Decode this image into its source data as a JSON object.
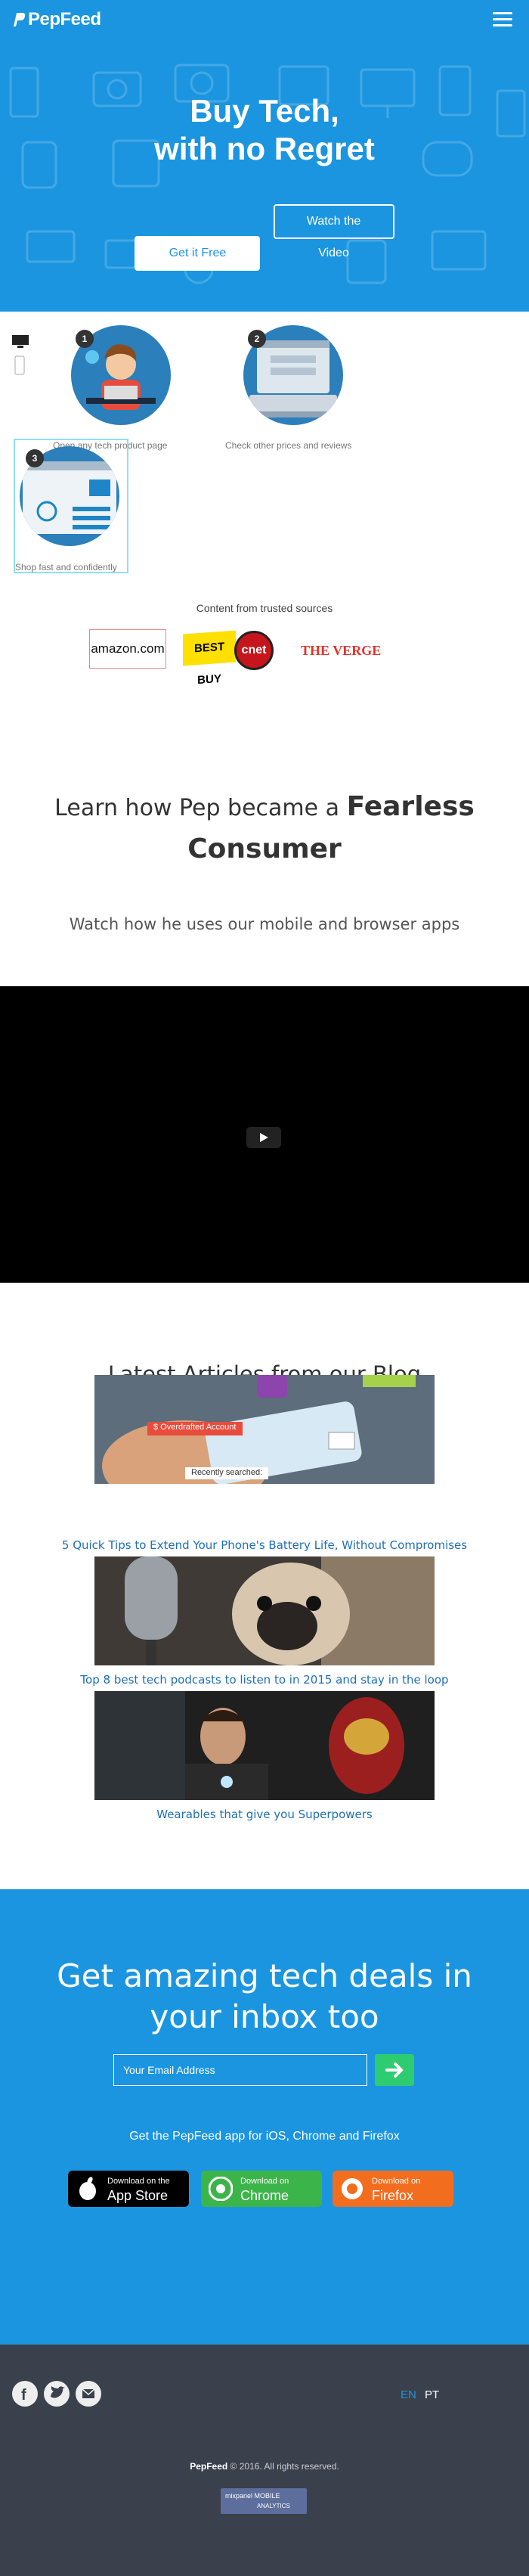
{
  "nav": {
    "logo": "PepFeed"
  },
  "hero": {
    "title_line1": "Buy Tech,",
    "title_line2": "with no Regret",
    "cta_primary": "Get it Free",
    "cta_secondary": "Watch the Video"
  },
  "steps": [
    {
      "number": "1",
      "caption": "Open any tech product page"
    },
    {
      "number": "2",
      "caption": "Check other prices and reviews"
    },
    {
      "number": "3",
      "caption": "Shop fast and confidently"
    }
  ],
  "sources": {
    "title": "Content from trusted sources",
    "logos": [
      "amazon.com",
      "BEST BUY",
      "cnet",
      "THE VERGE"
    ]
  },
  "learn": {
    "prefix": "Learn how Pep became a",
    "bold_1": "Fearless",
    "bold_2": "Consumer",
    "subtitle": "Watch how he uses our mobile and browser apps"
  },
  "blog": {
    "title": "Latest Articles from our Blog",
    "articles": [
      {
        "title": "5 Quick Tips to Extend Your Phone's Battery Life, Without Compromises",
        "img_text_1": "$ Overdrafted Account",
        "img_text_2": "Recently searched:"
      },
      {
        "title": "Top 8 best tech podcasts to listen to in 2015 and stay in the loop"
      },
      {
        "title": "Wearables that give you Superpowers"
      }
    ]
  },
  "newsletter": {
    "title_line1": "Get amazing tech deals in",
    "title_line2": "your inbox too",
    "email_placeholder": "Your Email Address",
    "apps_text": "Get the PepFeed app for iOS, Chrome and Firefox",
    "stores": [
      {
        "line1": "Download on the",
        "line2": "App Store",
        "color": "#000000"
      },
      {
        "line1": "Download on",
        "line2": "Chrome",
        "color": "#3bb54a"
      },
      {
        "line1": "Download on",
        "line2": "Firefox",
        "color": "#f36d1f"
      }
    ]
  },
  "footer": {
    "languages": [
      "EN",
      "PT"
    ],
    "active_language": "EN",
    "copyright_brand": "PepFeed",
    "copyright_text": "© 2016. All rights reserved.",
    "badge_line1": "mixpanel MOBILE",
    "badge_line2": "ANALYTICS"
  },
  "colors": {
    "brand": "#1b95e0",
    "footer": "#3a414d",
    "link": "#1e6fb6",
    "submit": "#2ecc71"
  }
}
